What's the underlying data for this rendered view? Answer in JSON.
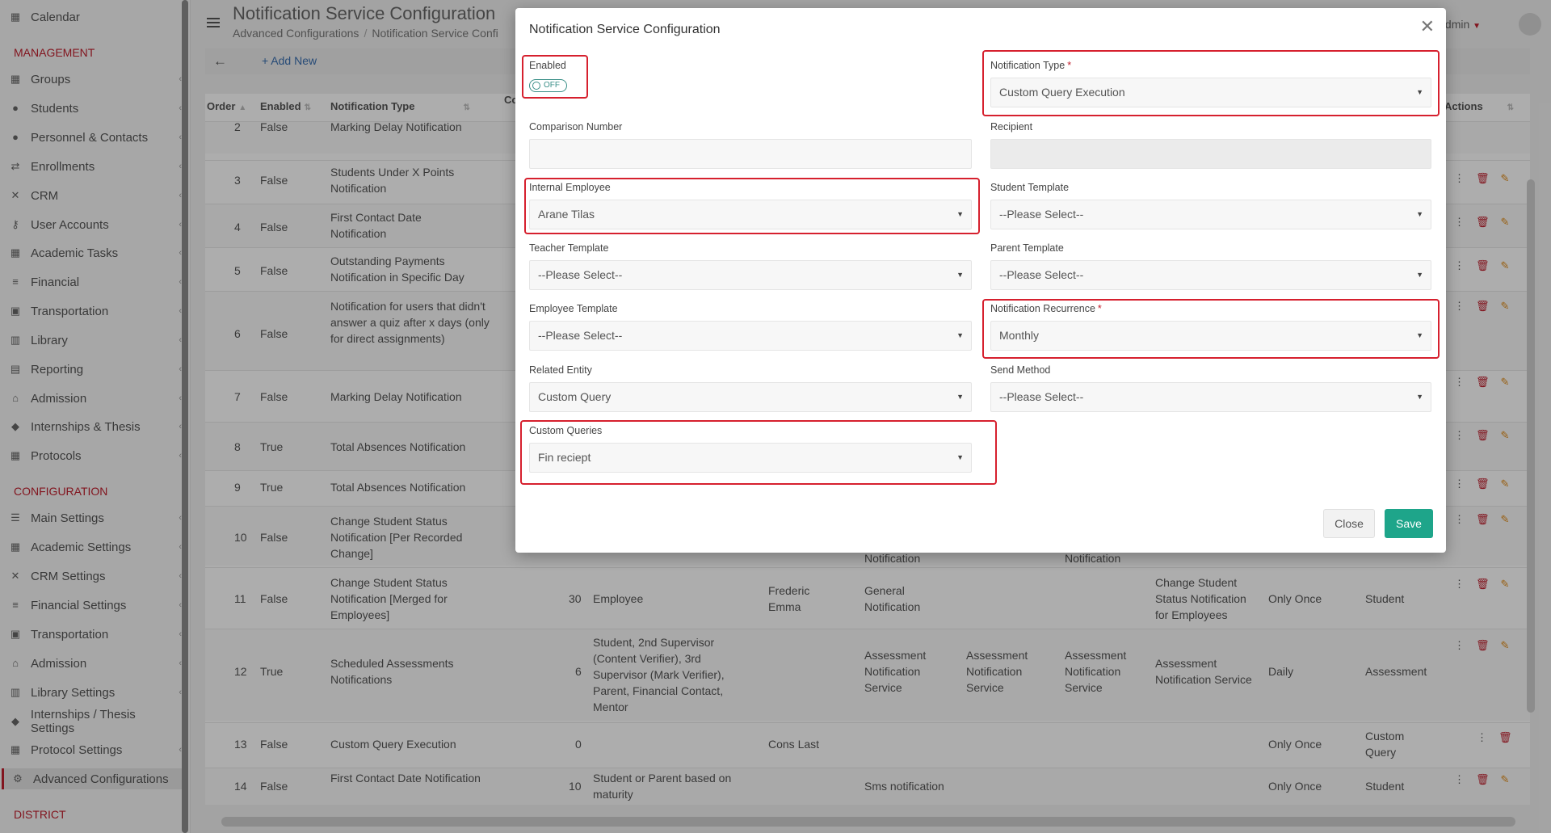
{
  "sidebar": {
    "top_item": "Calendar",
    "section_management": "MANAGEMENT",
    "management_items": [
      "Groups",
      "Students",
      "Personnel & Contacts",
      "Enrollments",
      "CRM",
      "User Accounts",
      "Academic Tasks",
      "Financial",
      "Transportation",
      "Library",
      "Reporting",
      "Admission",
      "Internships & Thesis",
      "Protocols"
    ],
    "section_configuration": "CONFIGURATION",
    "configuration_items": [
      "Main Settings",
      "Academic Settings",
      "CRM Settings",
      "Financial Settings",
      "Transportation",
      "Admission",
      "Library Settings",
      "Internships / Thesis Settings",
      "Protocol Settings",
      "Advanced Configurations"
    ],
    "section_district": "DISTRICT"
  },
  "header": {
    "title": "Notification Service Configuration",
    "breadcrumb": [
      "Advanced Configurations",
      "Notification Service Confi"
    ],
    "user": "er Admin"
  },
  "toolbar": {
    "add_new": "Add New"
  },
  "table": {
    "headers": {
      "order": "Order",
      "enabled": "Enabled",
      "type": "Notification Type",
      "co": "Co",
      "actions": "Actions"
    },
    "rows": [
      {
        "order": "2",
        "enabled": "False",
        "type": "Marking Delay Notification"
      },
      {
        "order": "3",
        "enabled": "False",
        "type": "Students Under X Points Notification"
      },
      {
        "order": "4",
        "enabled": "False",
        "type": "First Contact Date Notification"
      },
      {
        "order": "5",
        "enabled": "False",
        "type": "Outstanding Payments Notification in Specific Day"
      },
      {
        "order": "6",
        "enabled": "False",
        "type": "Notification for users that didn't answer a quiz after x days (only for direct assignments)"
      },
      {
        "order": "7",
        "enabled": "False",
        "type": "Marking Delay Notification"
      },
      {
        "order": "8",
        "enabled": "True",
        "type": "Total Absences Notification"
      },
      {
        "order": "9",
        "enabled": "True",
        "type": "Total Absences Notification"
      },
      {
        "order": "10",
        "enabled": "False",
        "type": "Change Student Status Notification [Per Recorded Change]",
        "c5": "Notification",
        "c7": "Notification"
      },
      {
        "order": "11",
        "enabled": "False",
        "type": "Change Student Status Notification [Merged for Employees]",
        "number": "30",
        "recipient": "Employee",
        "employee": "Frederic Emma",
        "c5": "General Notification",
        "c8": "Change Student Status Notification for Employees",
        "recurrence": "Only Once",
        "entity": "Student"
      },
      {
        "order": "12",
        "enabled": "True",
        "type": "Scheduled Assessments Notifications",
        "number": "6",
        "recipient": "Student, 2nd Supervisor (Content Verifier), 3rd Supervisor (Mark Verifier), Parent, Financial Contact, Mentor",
        "c5": "Assessment Notification Service",
        "c6": "Assessment Notification Service",
        "c7": "Assessment Notification Service",
        "c8": "Assessment Notification Service",
        "recurrence": "Daily",
        "entity": "Assessment"
      },
      {
        "order": "13",
        "enabled": "False",
        "type": "Custom Query Execution",
        "number": "0",
        "employee": "Cons Last",
        "recurrence": "Only Once",
        "entity": "Custom Query"
      },
      {
        "order": "14",
        "enabled": "False",
        "type": "First Contact Date Notification",
        "number": "10",
        "recipient": "Student or Parent based on maturity",
        "c5": "Sms notification",
        "recurrence": "Only Once",
        "entity": "Student"
      }
    ]
  },
  "modal": {
    "title": "Notification Service Configuration",
    "enabled_label": "Enabled",
    "enabled_state": "OFF",
    "notification_type_label": "Notification Type",
    "notification_type_value": "Custom Query Execution",
    "comparison_number_label": "Comparison Number",
    "comparison_number_value": "",
    "recipient_label": "Recipient",
    "recipient_value": "",
    "internal_employee_label": "Internal Employee",
    "internal_employee_value": "Arane Tilas",
    "student_template_label": "Student Template",
    "student_template_value": "--Please Select--",
    "teacher_template_label": "Teacher Template",
    "teacher_template_value": "--Please Select--",
    "parent_template_label": "Parent Template",
    "parent_template_value": "--Please Select--",
    "employee_template_label": "Employee Template",
    "employee_template_value": "--Please Select--",
    "recurrence_label": "Notification Recurrence",
    "recurrence_value": "Monthly",
    "related_entity_label": "Related Entity",
    "related_entity_value": "Custom Query",
    "send_method_label": "Send Method",
    "send_method_value": "--Please Select--",
    "custom_queries_label": "Custom Queries",
    "custom_queries_value": "Fin reciept",
    "close_button": "Close",
    "save_button": "Save"
  },
  "colors": {
    "accent_red": "#c0202e",
    "save_green": "#1ea58a",
    "toggle_teal": "#3a8f88"
  }
}
